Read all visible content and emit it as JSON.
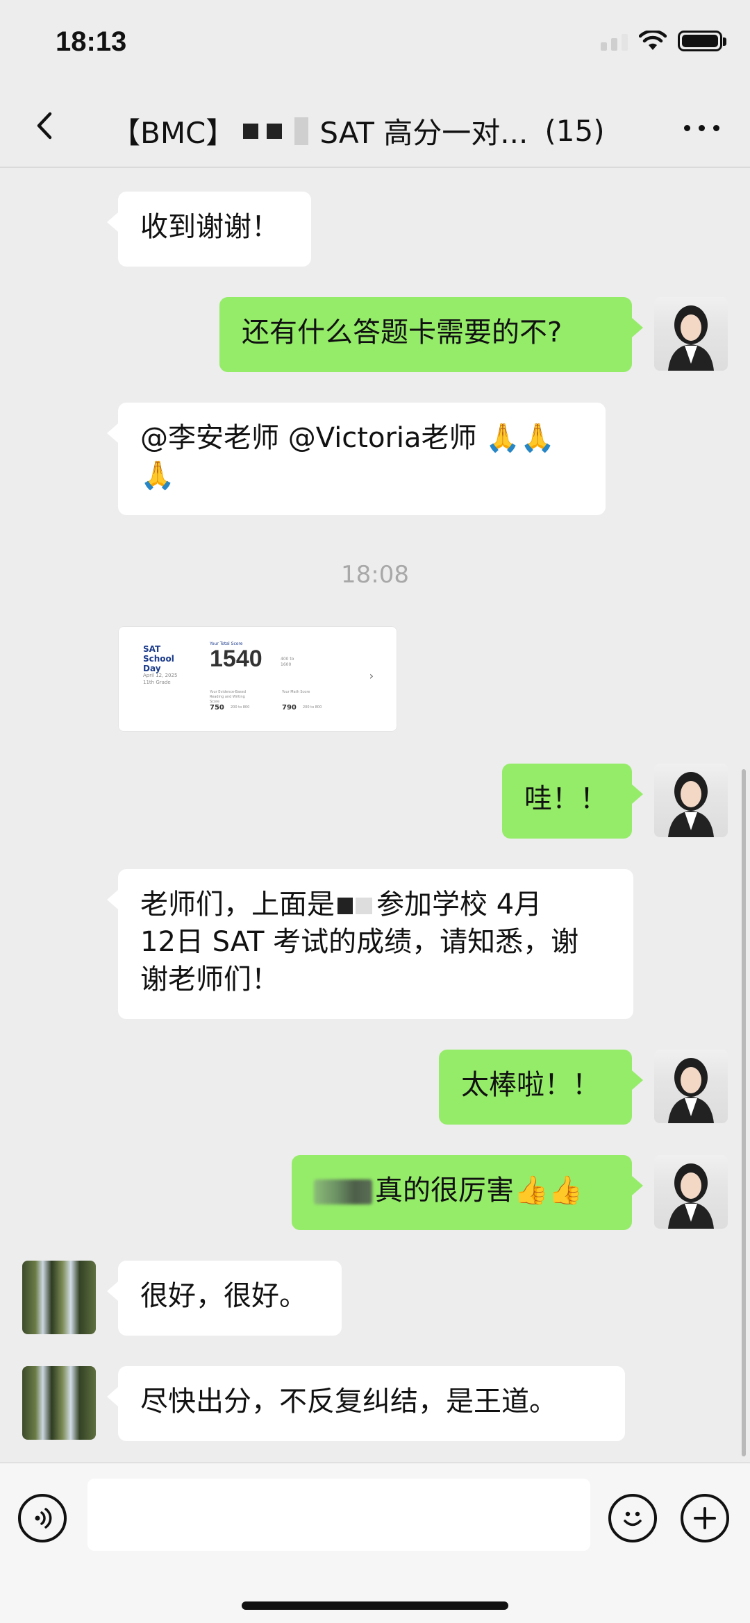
{
  "status_bar": {
    "time": "18:13"
  },
  "header": {
    "title_prefix": "【BMC】",
    "title_suffix": "SAT 高分一对...",
    "member_count": "(15)"
  },
  "messages": [
    {
      "id": "m1",
      "side": "in",
      "text": "收到谢谢！"
    },
    {
      "id": "m2",
      "side": "out",
      "text": "还有什么答题卡需要的不?"
    },
    {
      "id": "m3",
      "side": "in",
      "text_line1": "@李安老师 @Victoria老师 🙏🙏",
      "text_line2": "🙏"
    },
    {
      "id": "m4",
      "side": "out",
      "text": "哇！！"
    },
    {
      "id": "m5",
      "side": "in",
      "text_a": "老师们，上面是",
      "text_b": "参加学校 4月",
      "text_line2": "12日 SAT 考试的成绩，请知悉，谢",
      "text_line3": "谢老师们！"
    },
    {
      "id": "m6",
      "side": "out",
      "text": "太棒啦！！"
    },
    {
      "id": "m7",
      "side": "out",
      "text": "真的很厉害👍👍"
    },
    {
      "id": "m8",
      "side": "in",
      "text": "很好，很好。"
    },
    {
      "id": "m9",
      "side": "in",
      "text": "尽快出分，不反复纠结，是王道。"
    }
  ],
  "timestamp": "18:08",
  "score_card": {
    "title": "SAT School Day",
    "date": "April 12, 2025",
    "grade": "11th Grade",
    "total_label": "Your Total Score",
    "total": "1540",
    "range": "400 to 1600",
    "section1_label": "Your Evidence-Based Reading and Writing Score",
    "section1_value": "750",
    "section1_range": "200 to 800",
    "section2_label": "Your Math Score",
    "section2_value": "790",
    "section2_range": "200 to 800",
    "chevron": "›"
  },
  "input": {
    "placeholder": "",
    "voice_icon": "🔊",
    "emoji_icon": "☺",
    "plus_icon": "+"
  }
}
